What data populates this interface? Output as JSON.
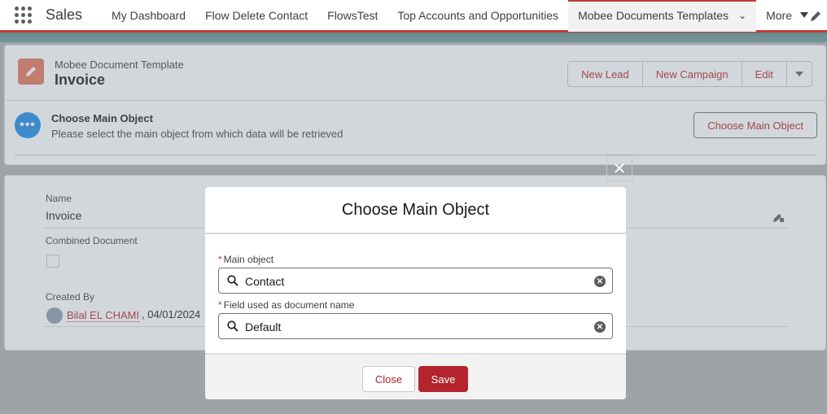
{
  "topnav": {
    "app_name": "Sales",
    "items": [
      {
        "label": "My Dashboard"
      },
      {
        "label": "Flow Delete Contact"
      },
      {
        "label": "FlowsTest"
      },
      {
        "label": "Top Accounts and Opportunities"
      },
      {
        "label": "Mobee Documents Templates"
      }
    ],
    "more_label": "More"
  },
  "record": {
    "object_label": "Mobee Document Template",
    "title": "Invoice",
    "actions": {
      "new_lead": "New Lead",
      "new_campaign": "New Campaign",
      "edit": "Edit"
    },
    "choose": {
      "title": "Choose Main Object",
      "description": "Please select the main object from which data will be retrieved",
      "button_label": "Choose Main Object"
    }
  },
  "details": {
    "name_label": "Name",
    "name_value": "Invoice",
    "combined_label": "Combined Document",
    "created_by_label": "Created By",
    "created_by_name": "Bilal EL CHAMI",
    "created_by_date": ", 04/01/2024"
  },
  "modal": {
    "title": "Choose Main Object",
    "main_object_label": "Main object",
    "main_object_value": "Contact",
    "doc_name_label": "Field used as document name",
    "doc_name_value": "Default",
    "required_marker": "*",
    "close_label": "Close",
    "save_label": "Save"
  },
  "colors": {
    "brand": "#b4242d",
    "record_icon": "#e3735a",
    "info_icon": "#1b8ae8"
  }
}
